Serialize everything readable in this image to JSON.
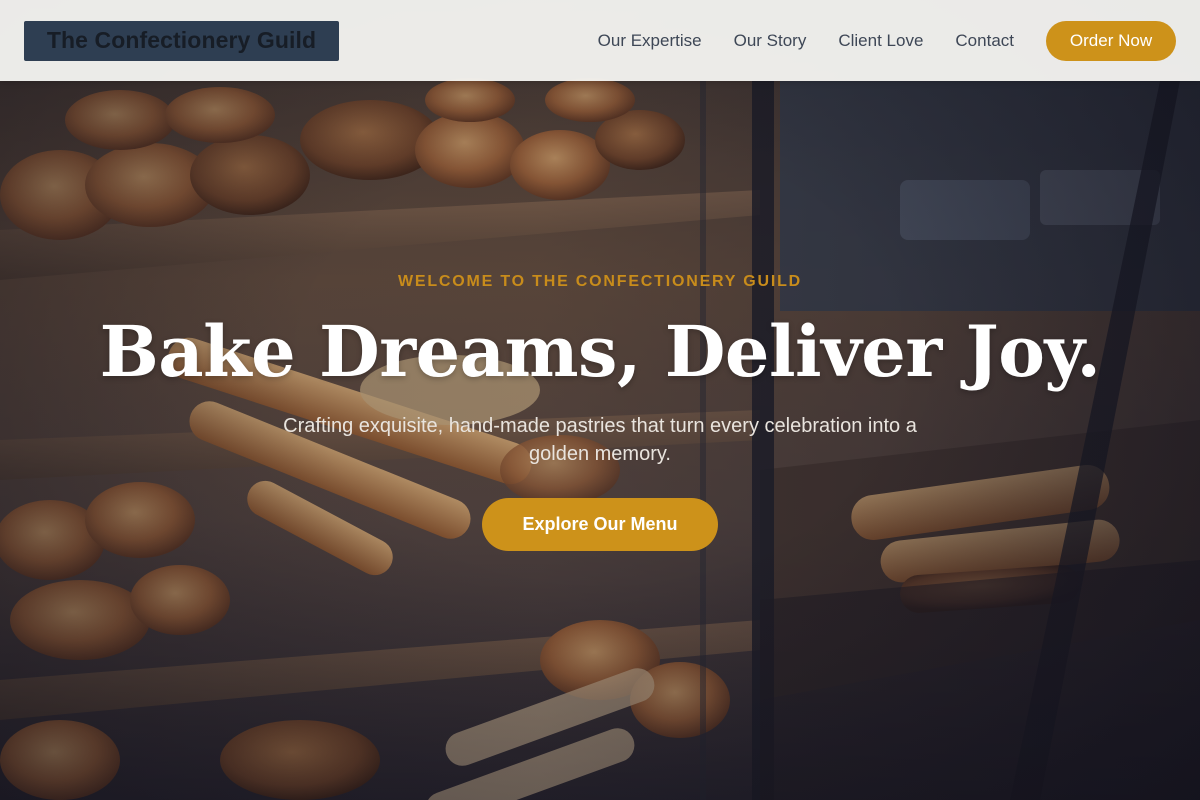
{
  "header": {
    "brand": "The Confectionery Guild",
    "nav": [
      "Our Expertise",
      "Our Story",
      "Client Love",
      "Contact"
    ],
    "order_label": "Order Now"
  },
  "hero": {
    "eyebrow": "WELCOME TO THE CONFECTIONERY GUILD",
    "headline": "Bake Dreams, Deliver Joy.",
    "subtitle": "Crafting exquisite, hand-made pastries that turn every celebration into a golden memory.",
    "cta_label": "Explore Our Menu"
  },
  "colors": {
    "accent": "#cd921a",
    "brand_bg": "#2e3e52",
    "header_bg": "#f6f5f2",
    "nav_text": "#3e4756"
  }
}
